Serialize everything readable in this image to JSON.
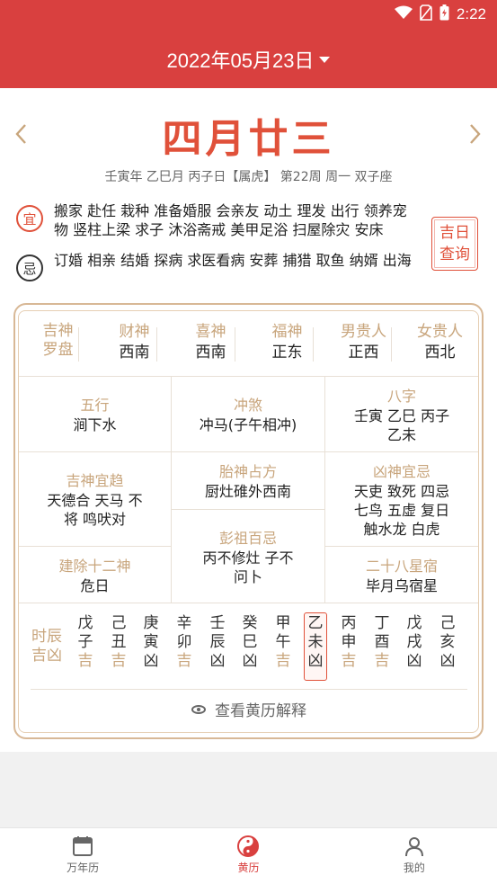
{
  "status_bar": {
    "time": "2:22"
  },
  "header": {
    "date": "2022年05月23日"
  },
  "day": {
    "lunar": "四月廿三",
    "ganzhi": "壬寅年 乙巳月 丙子日【属虎】 第22周 周一 双子座"
  },
  "yi": {
    "badge": "宜",
    "text": "搬家 赴任 栽种 准备婚服 会亲友 动土 理发 出行 领养宠物 竖柱上梁 求子 沐浴斋戒 美甲足浴 扫屋除灾 安床"
  },
  "ji": {
    "badge": "忌",
    "text": "订婚 相亲 结婚 探病 求医看病 安葬 捕猎 取鱼 纳婿 出海"
  },
  "jiri_button": {
    "line1": "吉日",
    "line2": "查询"
  },
  "gods": {
    "title1": "吉神",
    "title2": "罗盘",
    "items": [
      {
        "title": "财神",
        "value": "西南"
      },
      {
        "title": "喜神",
        "value": "西南"
      },
      {
        "title": "福神",
        "value": "正东"
      },
      {
        "title": "男贵人",
        "value": "正西"
      },
      {
        "title": "女贵人",
        "value": "西北"
      }
    ]
  },
  "info": {
    "wuxing": {
      "title": "五行",
      "value": "涧下水"
    },
    "chongsha": {
      "title": "冲煞",
      "value": "冲马(子午相冲)"
    },
    "bazi": {
      "title": "八字",
      "value1": "壬寅 乙巳 丙子",
      "value2": "乙未"
    },
    "jishen": {
      "title": "吉神宜趋",
      "value1": "天德合 天马 不",
      "value2": "将 鸣吠对"
    },
    "taishen": {
      "title": "胎神占方",
      "value": "厨灶碓外西南"
    },
    "xiongshen": {
      "title": "凶神宜忌",
      "value1": "天吏 致死 四忌",
      "value2": "七鸟 五虚 复日",
      "value3": "触水龙 白虎"
    },
    "jianchu": {
      "title": "建除十二神",
      "value": "危日"
    },
    "pengzu": {
      "title": "彭祖百忌",
      "value1": "丙不修灶 子不",
      "value2": "问卜"
    },
    "xingxiu": {
      "title": "二十八星宿",
      "value": "毕月乌宿星"
    }
  },
  "shichen": {
    "label1": "时辰",
    "label2": "吉凶",
    "hours": [
      {
        "g1": "戊",
        "g2": "子",
        "r": "吉"
      },
      {
        "g1": "己",
        "g2": "丑",
        "r": "吉"
      },
      {
        "g1": "庚",
        "g2": "寅",
        "r": "凶"
      },
      {
        "g1": "辛",
        "g2": "卯",
        "r": "吉"
      },
      {
        "g1": "壬",
        "g2": "辰",
        "r": "凶"
      },
      {
        "g1": "癸",
        "g2": "巳",
        "r": "凶"
      },
      {
        "g1": "甲",
        "g2": "午",
        "r": "吉"
      },
      {
        "g1": "乙",
        "g2": "未",
        "r": "凶"
      },
      {
        "g1": "丙",
        "g2": "申",
        "r": "吉"
      },
      {
        "g1": "丁",
        "g2": "酉",
        "r": "吉"
      },
      {
        "g1": "戊",
        "g2": "戌",
        "r": "凶"
      },
      {
        "g1": "己",
        "g2": "亥",
        "r": "凶"
      }
    ],
    "active_index": 7
  },
  "explain_link": "查看黄历解释",
  "bottom_nav": [
    {
      "label": "万年历",
      "icon": "calendar-icon"
    },
    {
      "label": "黄历",
      "icon": "yinyang-icon"
    },
    {
      "label": "我的",
      "icon": "person-icon"
    }
  ],
  "colors": {
    "primary": "#d9403f",
    "gold": "#c8a57c",
    "lunar": "#e0513a"
  }
}
